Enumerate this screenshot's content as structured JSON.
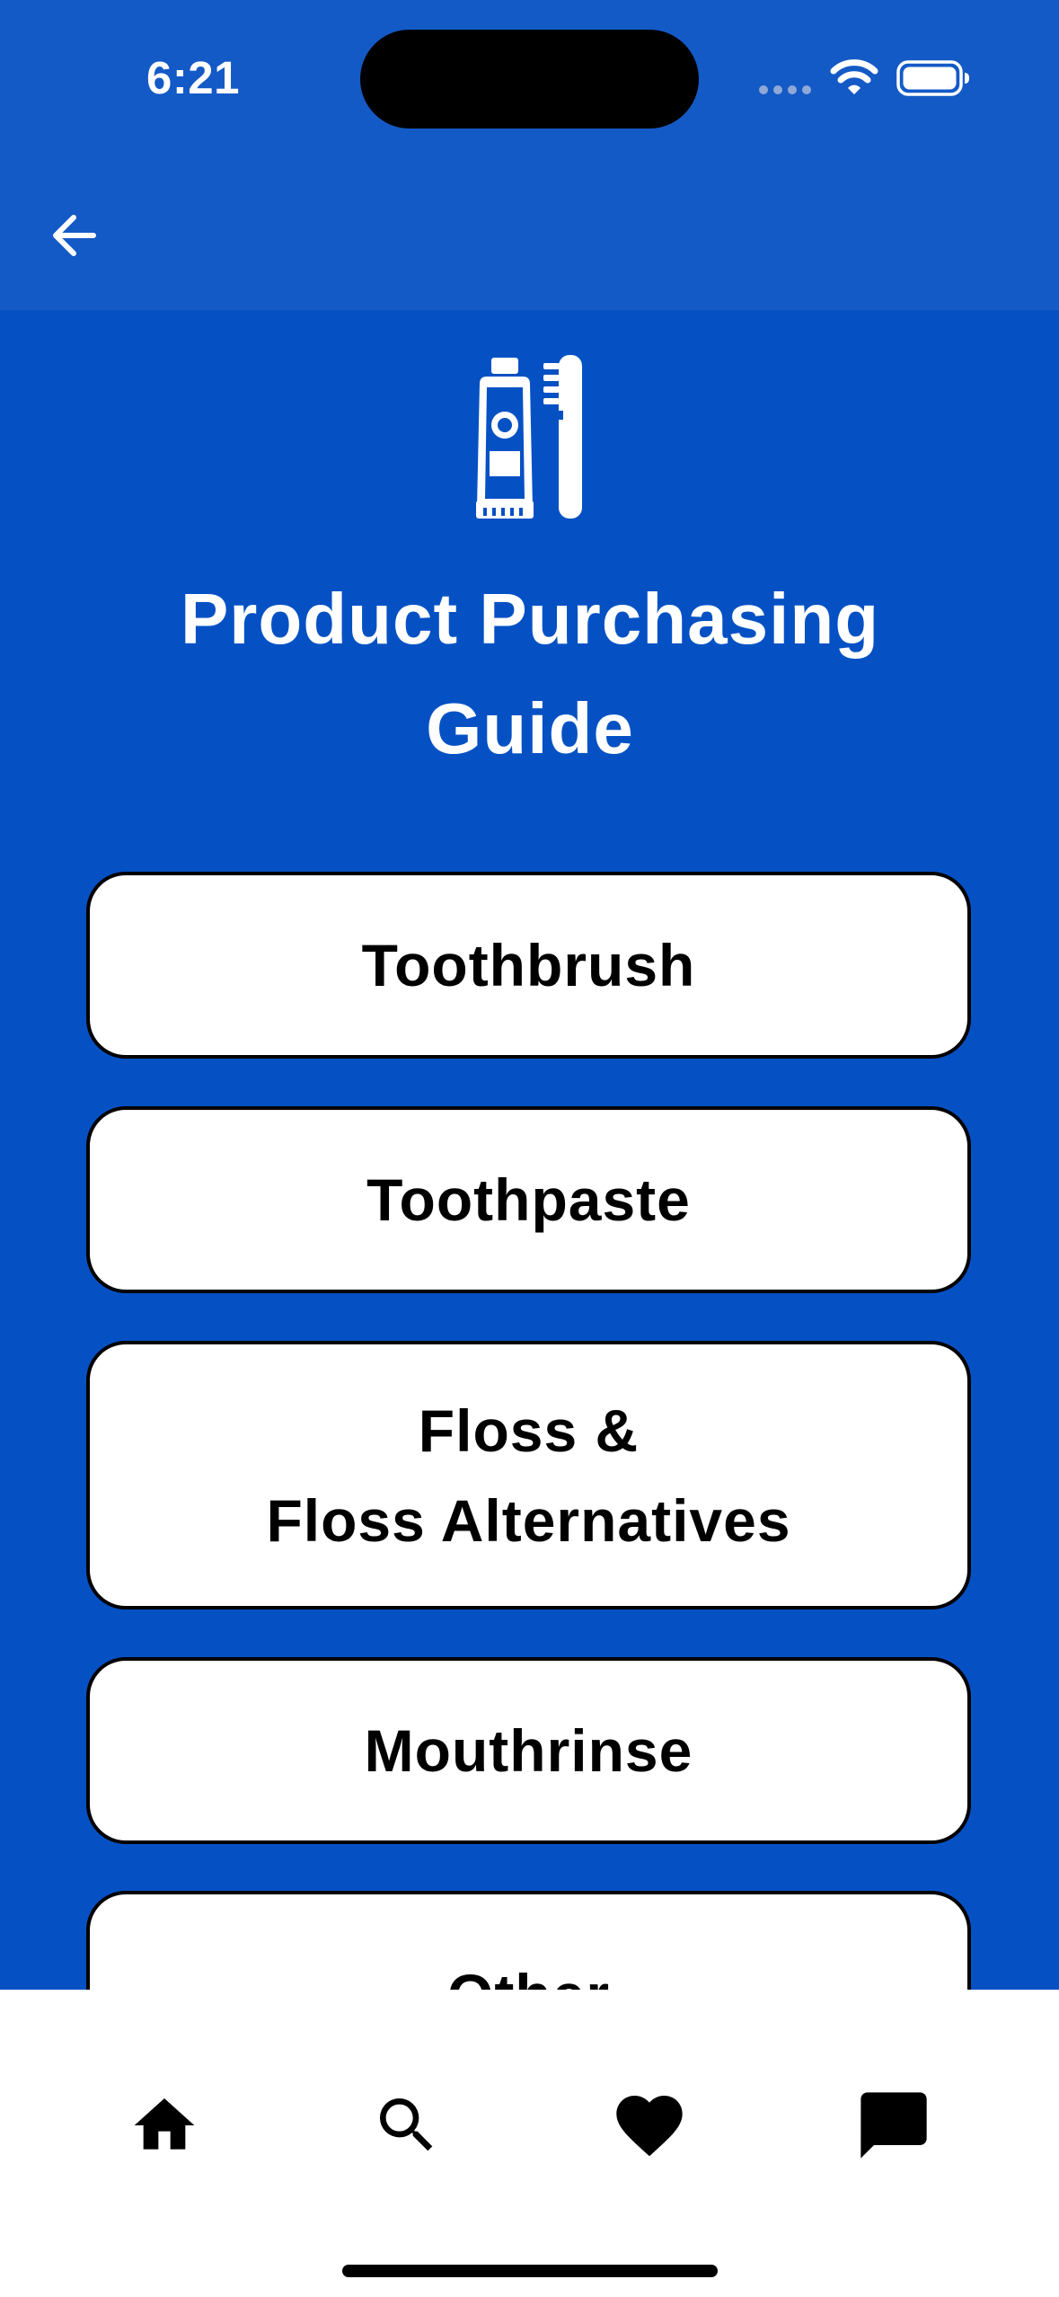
{
  "status_bar": {
    "time": "6:21",
    "icons": [
      "cellular-dots-icon",
      "wifi-icon",
      "battery-icon"
    ]
  },
  "nav_bar": {
    "back_icon": "arrow-left-icon"
  },
  "header": {
    "logo_icon": "toothpaste-toothbrush-icon",
    "title": "Product Purchasing Guide"
  },
  "options": [
    {
      "label": "Toothbrush"
    },
    {
      "label": "Toothpaste"
    },
    {
      "label": "Floss &\nFloss Alternatives"
    },
    {
      "label": "Mouthrinse"
    },
    {
      "label": "Other"
    }
  ],
  "bottom_nav": {
    "items": [
      {
        "icon": "home-icon"
      },
      {
        "icon": "search-icon"
      },
      {
        "icon": "heart-icon"
      },
      {
        "icon": "chat-icon"
      }
    ]
  },
  "colors": {
    "background": "#0551C4",
    "header_background": "#145AC6",
    "button_background": "#FFFFFF",
    "button_border": "#000000",
    "title_text": "#FFFFFF"
  }
}
